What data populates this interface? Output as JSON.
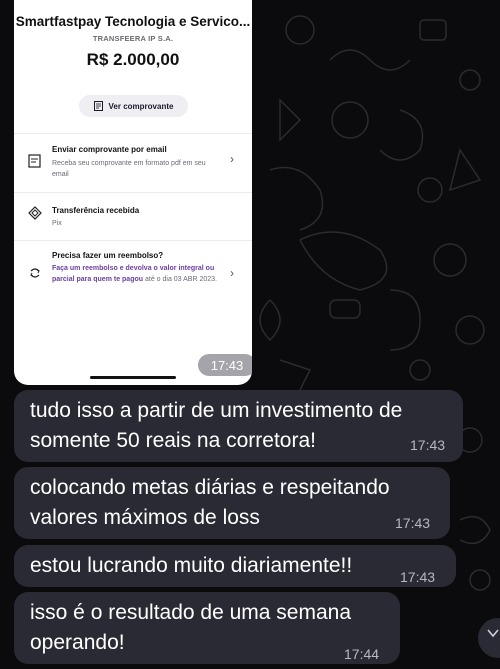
{
  "receipt": {
    "company": "Smartfastpay Tecnologia e Servico...",
    "bank": "TRANSFEERA IP S.A.",
    "amount": "R$ 2.000,00",
    "view_receipt_label": "Ver comprovante",
    "email_option": {
      "title": "Enviar comprovante por email",
      "subtitle": "Receba seu comprovante em formato pdf em seu email",
      "icon": "document-icon"
    },
    "transfer_option": {
      "title": "Transferência recebida",
      "subtitle": "Pix",
      "icon": "pix-icon"
    },
    "refund_option": {
      "title": "Precisa fazer um reembolso?",
      "subtitle_highlight": "Faça um reembolso e devolva o valor integral ou parcial para quem te pagou",
      "subtitle_rest": " até o dia 03 ABR 2023.",
      "icon": "refund-icon"
    },
    "time": "17:43"
  },
  "messages": [
    {
      "text": "tudo isso a partir de um investimento de\nsomente 50 reais na corretora!",
      "time": "17:43"
    },
    {
      "text": "colocando metas diárias e respeitando\nvalores máximos de loss",
      "time": "17:43"
    },
    {
      "text": "estou lucrando muito diariamente!!",
      "time": "17:43"
    },
    {
      "text": "isso é o resultado de uma semana\noperando!",
      "time": "17:44"
    }
  ],
  "colors": {
    "background": "#0b0b0d",
    "bubble": "#2a2a35",
    "highlight": "#6b3fa0"
  },
  "scroll_icon": "chevron-down-icon"
}
